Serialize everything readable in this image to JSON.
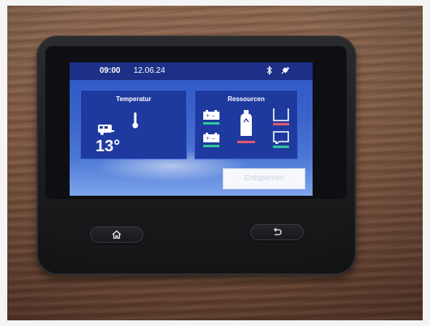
{
  "statusbar": {
    "time": "09:00",
    "date": "12.06.24",
    "icons": [
      "bluetooth-icon",
      "power-plug-icon"
    ]
  },
  "temperature_tile": {
    "title": "Temperatur",
    "value": "13°",
    "icons": [
      "camper-icon",
      "thermometer-icon"
    ]
  },
  "resources_tile": {
    "title": "Ressourcen",
    "icons": [
      "battery-icon",
      "gas-bottle-icon",
      "fresh-water-tank-icon",
      "grey-water-tank-icon"
    ]
  },
  "unlock_button": {
    "label": "Entsperren"
  },
  "hardware_buttons": {
    "icons": [
      "home-icon",
      "back-arrow-icon"
    ]
  },
  "colors": {
    "screen_blue": "#3a63c9",
    "statusbar_blue": "#1d2f86",
    "tile_blue": "#1f3a9e",
    "level_green": "#2ec79a",
    "level_red": "#e05a6a"
  }
}
